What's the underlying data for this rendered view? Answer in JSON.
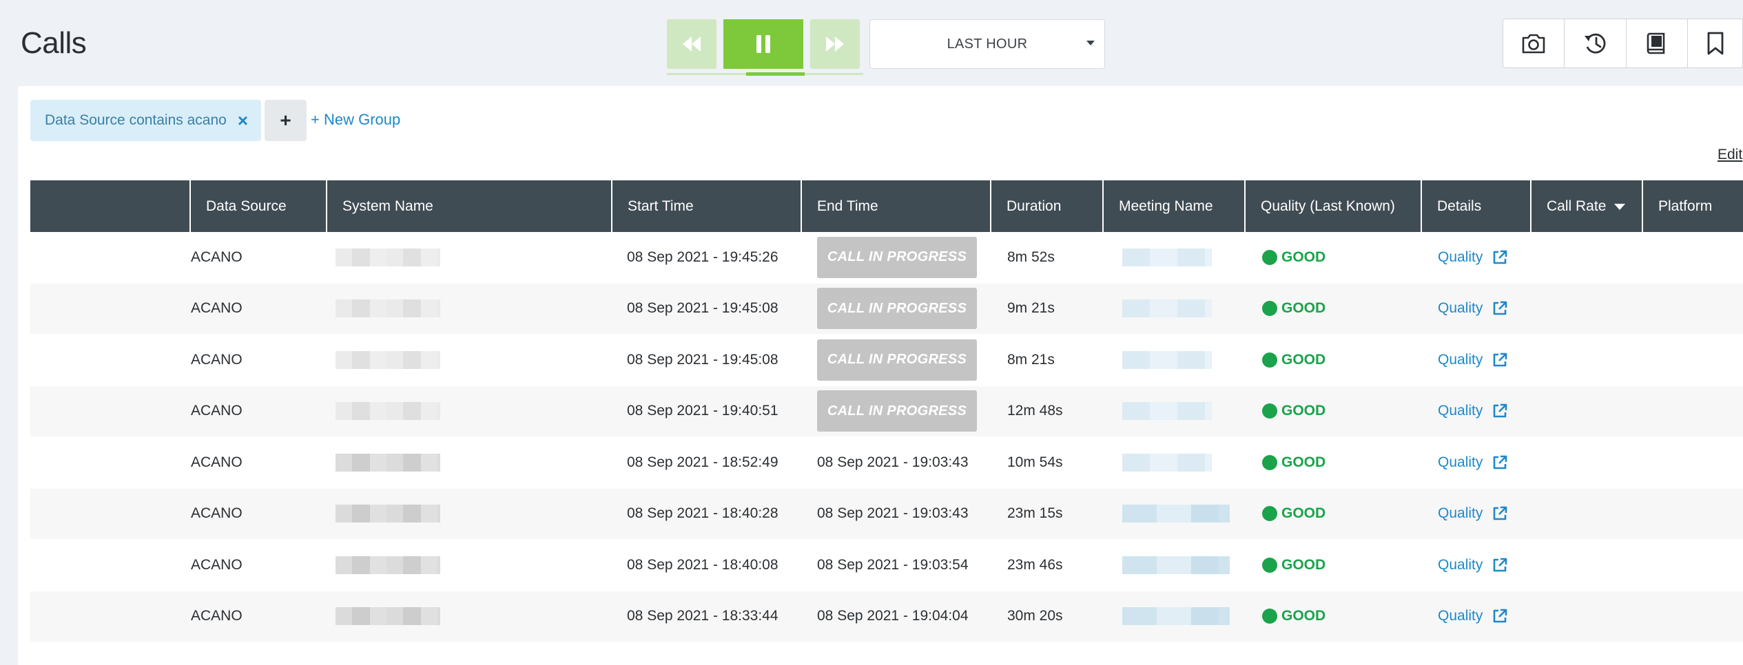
{
  "header": {
    "title": "Calls",
    "time_range": "LAST HOUR"
  },
  "playback": {
    "rewind_icon": "rewind-icon",
    "pause_icon": "pause-icon",
    "forward_icon": "fast-forward-icon",
    "accent": "#7ec93b"
  },
  "tools": [
    {
      "icon": "camera-icon"
    },
    {
      "icon": "history-icon"
    },
    {
      "icon": "saved-view-icon"
    },
    {
      "icon": "bookmark-icon"
    }
  ],
  "filters": {
    "chip_label": "Data Source contains acano",
    "remove_symbol": "×",
    "add_symbol": "+",
    "new_group": "+ New Group"
  },
  "edit_label": "Edit",
  "table": {
    "columns": [
      "",
      "Data Source",
      "System Name",
      "Start Time",
      "End Time",
      "Duration",
      "Meeting Name",
      "Quality (Last Known)",
      "Details",
      "Call Rate",
      "Platform"
    ],
    "rows": [
      {
        "data_source": "ACANO",
        "start": "08 Sep 2021 - 19:45:26",
        "end": "CALL IN PROGRESS",
        "in_progress": true,
        "duration": "8m 52s",
        "quality": "GOOD",
        "details": "Quality"
      },
      {
        "data_source": "ACANO",
        "start": "08 Sep 2021 - 19:45:08",
        "end": "CALL IN PROGRESS",
        "in_progress": true,
        "duration": "9m 21s",
        "quality": "GOOD",
        "details": "Quality"
      },
      {
        "data_source": "ACANO",
        "start": "08 Sep 2021 - 19:45:08",
        "end": "CALL IN PROGRESS",
        "in_progress": true,
        "duration": "8m 21s",
        "quality": "GOOD",
        "details": "Quality"
      },
      {
        "data_source": "ACANO",
        "start": "08 Sep 2021 - 19:40:51",
        "end": "CALL IN PROGRESS",
        "in_progress": true,
        "duration": "12m 48s",
        "quality": "GOOD",
        "details": "Quality"
      },
      {
        "data_source": "ACANO",
        "start": "08 Sep 2021 - 18:52:49",
        "end": "08 Sep 2021 - 19:03:43",
        "in_progress": false,
        "duration": "10m 54s",
        "quality": "GOOD",
        "details": "Quality"
      },
      {
        "data_source": "ACANO",
        "start": "08 Sep 2021 - 18:40:28",
        "end": "08 Sep 2021 - 19:03:43",
        "in_progress": false,
        "duration": "23m 15s",
        "quality": "GOOD",
        "details": "Quality"
      },
      {
        "data_source": "ACANO",
        "start": "08 Sep 2021 - 18:40:08",
        "end": "08 Sep 2021 - 19:03:54",
        "in_progress": false,
        "duration": "23m 46s",
        "quality": "GOOD",
        "details": "Quality"
      },
      {
        "data_source": "ACANO",
        "start": "08 Sep 2021 - 18:33:44",
        "end": "08 Sep 2021 - 19:04:04",
        "in_progress": false,
        "duration": "30m 20s",
        "quality": "GOOD",
        "details": "Quality"
      }
    ],
    "good_color": "#1aa34a",
    "link_color": "#1e88c9"
  }
}
